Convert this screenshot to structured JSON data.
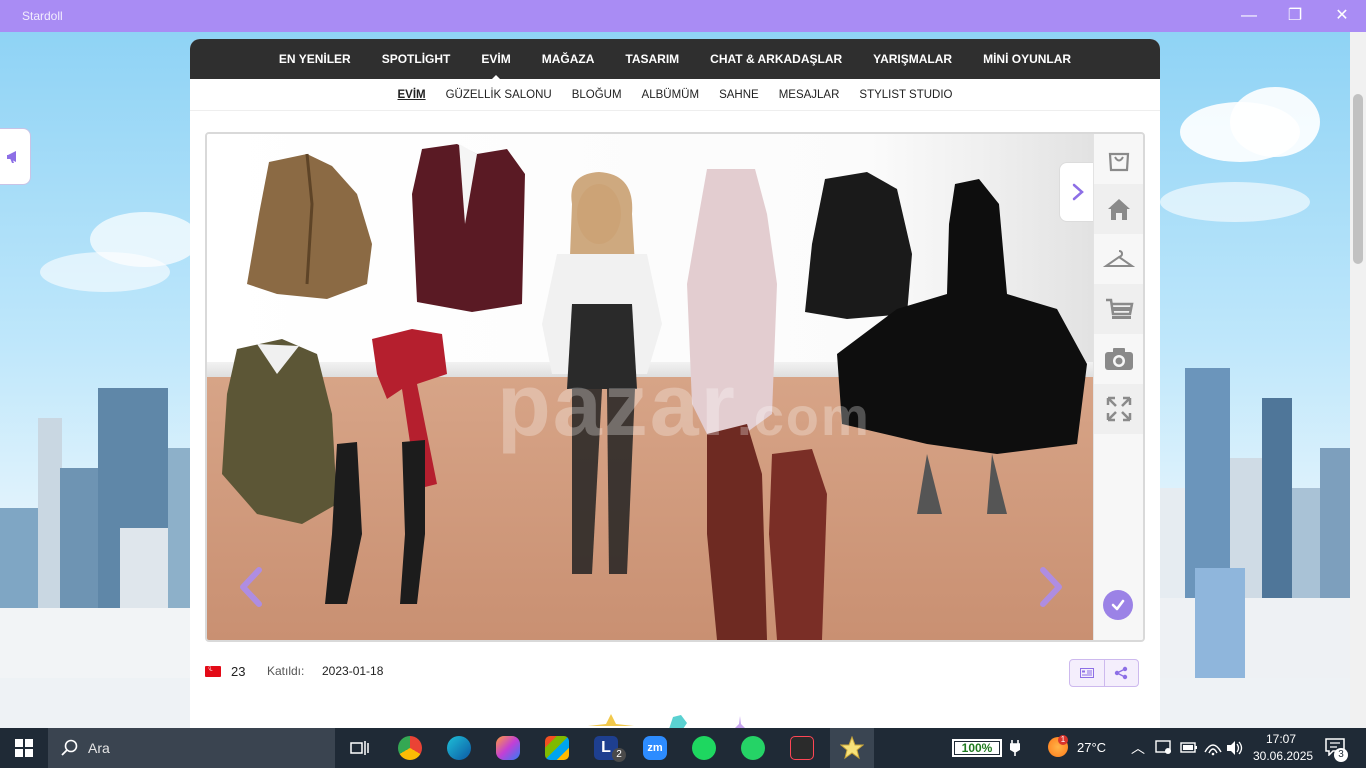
{
  "window": {
    "title": "Stardoll"
  },
  "main_nav": [
    {
      "label": "EN YENİLER",
      "active": false
    },
    {
      "label": "SPOTLİGHT",
      "active": false
    },
    {
      "label": "EVİM",
      "active": true
    },
    {
      "label": "MAĞAZA",
      "active": false
    },
    {
      "label": "TASARIM",
      "active": false
    },
    {
      "label": "CHAT & ARKADAŞLAR",
      "active": false
    },
    {
      "label": "YARIŞMALAR",
      "active": false
    },
    {
      "label": "MİNİ OYUNLAR",
      "active": false
    }
  ],
  "sub_nav": [
    {
      "label": "EVİM",
      "active": true
    },
    {
      "label": "GÜZELLİK SALONU",
      "active": false
    },
    {
      "label": "BLOĞUM",
      "active": false
    },
    {
      "label": "ALBÜMÜM",
      "active": false
    },
    {
      "label": "SAHNE",
      "active": false
    },
    {
      "label": "MESAJLAR",
      "active": false
    },
    {
      "label": "STYLIST STUDIO",
      "active": false
    }
  ],
  "stage": {
    "watermark": "pazar",
    "watermark_suffix": ".com",
    "tools": [
      "shopping-bag-icon",
      "home-icon",
      "hanger-icon",
      "cart-icon",
      "camera-icon",
      "fullscreen-icon"
    ]
  },
  "profile": {
    "age": "23",
    "joined_label": "Katıldı:",
    "joined_date": "2023-01-18"
  },
  "taskbar": {
    "search_label": "Ara",
    "battery_percent": "100%",
    "temperature": "27°C",
    "time": "17:07",
    "date": "30.06.2025",
    "notification_count": "3",
    "app_badge": "2",
    "weather_badge": "1"
  },
  "colors": {
    "title_bar": "#a98cf4",
    "accent": "#9b82e6",
    "nav_bg": "#2f2f2f",
    "taskbar_bg": "#1f2a36"
  }
}
